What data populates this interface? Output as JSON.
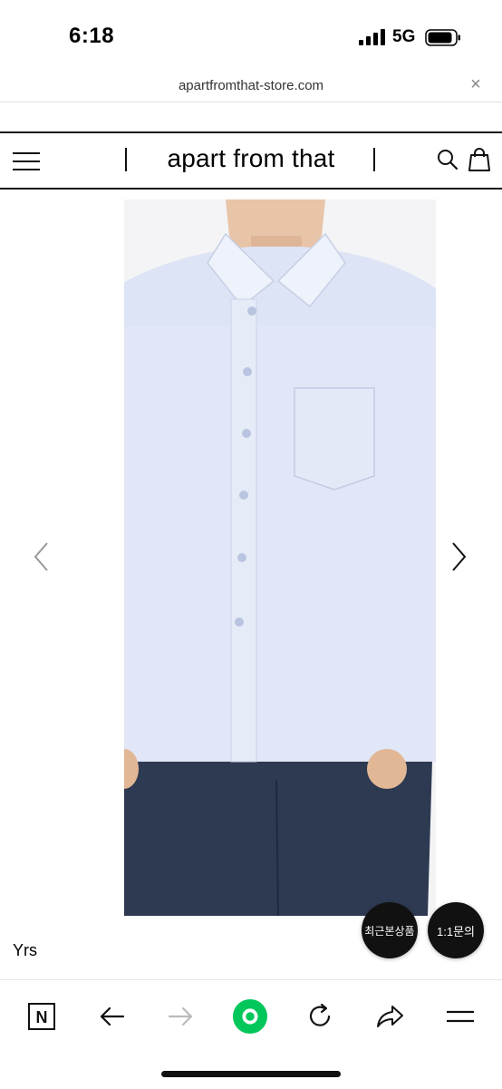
{
  "status_bar": {
    "time": "6:18",
    "network": "5G"
  },
  "browser": {
    "url": "apartfromthat-store.com",
    "close_glyph": "×"
  },
  "site_header": {
    "brand": "apart from that"
  },
  "product": {
    "name": "Yrs"
  },
  "floating_buttons": {
    "recent": "최근본상품",
    "inquiry": "1:1문의"
  },
  "toolbar": {
    "items": [
      "naver-home-icon",
      "back-icon",
      "forward-icon",
      "green-circle-icon",
      "refresh-icon",
      "share-icon",
      "menu-icon"
    ],
    "naver_letter": "N"
  },
  "colors": {
    "accent_green": "#03C75A",
    "dark": "#111111",
    "shirt": "#DCE3F4",
    "jeans": "#2D3A52"
  }
}
